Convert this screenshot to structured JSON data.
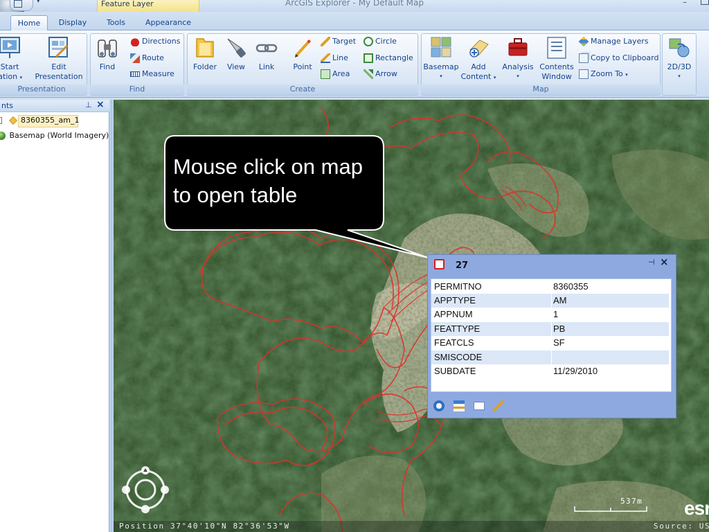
{
  "app": {
    "title": "ArcGIS Explorer - My Default Map",
    "context_tab_label": "Feature Layer"
  },
  "tabs": [
    {
      "label": "Home",
      "active": true
    },
    {
      "label": "Display"
    },
    {
      "label": "Tools"
    },
    {
      "label": "Appearance"
    }
  ],
  "ribbon": {
    "presentation": {
      "label": "Presentation",
      "start_label_1": "Start",
      "start_label_2": "Presentation",
      "edit_label_1": "Edit",
      "edit_label_2": "Presentation"
    },
    "find": {
      "label": "Find",
      "find_label": "Find",
      "directions": "Directions",
      "route": "Route",
      "measure": "Measure"
    },
    "create": {
      "label": "Create",
      "folder": "Folder",
      "view": "View",
      "link": "Link",
      "point": "Point",
      "target": "Target",
      "line": "Line",
      "area": "Area",
      "circle": "Circle",
      "rectangle": "Rectangle",
      "arrow": "Arrow"
    },
    "map": {
      "label": "Map",
      "basemap": "Basemap",
      "add_content_1": "Add",
      "add_content_2": "Content",
      "analysis": "Analysis",
      "contents_window_1": "Contents",
      "contents_window_2": "Window",
      "manage_layers": "Manage Layers",
      "copy_to_clipboard": "Copy to Clipboard",
      "zoom_to": "Zoom To"
    },
    "view2d3d": {
      "label": "2D/3D"
    }
  },
  "contents_pane": {
    "title": "nts",
    "items": [
      {
        "label": "8360355_am_1"
      },
      {
        "label": "Basemap (World Imagery)"
      }
    ]
  },
  "callout": {
    "line1": "Mouse click on map",
    "line2": "to open table"
  },
  "popup": {
    "title": "27",
    "rows": [
      {
        "field": "PERMITNO",
        "value": "8360355"
      },
      {
        "field": "APPTYPE",
        "value": "AM"
      },
      {
        "field": "APPNUM",
        "value": "1"
      },
      {
        "field": "FEATTYPE",
        "value": "PB"
      },
      {
        "field": "FEATCLS",
        "value": "SF"
      },
      {
        "field": "SMISCODE",
        "value": ""
      },
      {
        "field": "SUBDATE",
        "value": "11/29/2010"
      }
    ]
  },
  "status": {
    "position": "Position 37°40'10\"N  82°36'53\"W",
    "source": "Source: US",
    "scale": "537m",
    "logo": "esri"
  },
  "colors": {
    "ribbon_text": "#15428b",
    "boundary_red": "#e0302a",
    "popup_frame": "#8ea9df"
  }
}
